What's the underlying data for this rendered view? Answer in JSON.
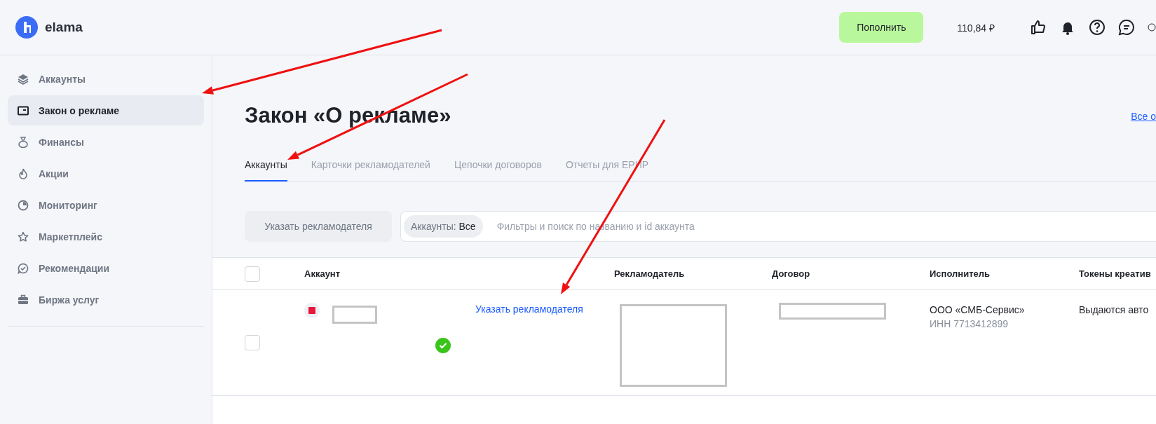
{
  "header": {
    "logo": "elama",
    "topup_button": "Пополнить",
    "balance": "110,84 ₽"
  },
  "sidebar": {
    "items": [
      {
        "label": "Аккаунты",
        "selected": false
      },
      {
        "label": "Закон о рекламе",
        "selected": true
      },
      {
        "label": "Финансы",
        "selected": false
      },
      {
        "label": "Акции",
        "selected": false
      },
      {
        "label": "Мониторинг",
        "selected": false
      },
      {
        "label": "Маркетплейс",
        "selected": false
      },
      {
        "label": "Рекомендации",
        "selected": false
      },
      {
        "label": "Биржа услуг",
        "selected": false
      }
    ]
  },
  "page": {
    "title": "Закон «О рекламе»",
    "corner_link": "Все о"
  },
  "tabs": [
    {
      "label": "Аккаунты",
      "selected": true
    },
    {
      "label": "Карточки рекламодателей",
      "selected": false
    },
    {
      "label": "Цепочки договоров",
      "selected": false
    },
    {
      "label": "Отчеты для ЕРИР",
      "selected": false
    }
  ],
  "toolbar": {
    "button": "Указать рекламодателя",
    "filter_chip_label": "Аккаунты:",
    "filter_chip_value": "Все",
    "search": {
      "placeholder": "Фильтры и поиск по названию и id аккаунта"
    }
  },
  "table": {
    "select_all_checked": false,
    "columns": [
      "Аккаунт",
      "",
      "Рекламодатель",
      "Договор",
      "Исполнитель",
      "Токены креатив"
    ],
    "rows": [
      {
        "checked": false,
        "verified": true,
        "link": "Указать рекламодателя",
        "executor": "ООО «СМБ-Сервис»",
        "executor_inn": "ИНН 7713412899",
        "tokens": "Выдаются авто"
      }
    ]
  }
}
